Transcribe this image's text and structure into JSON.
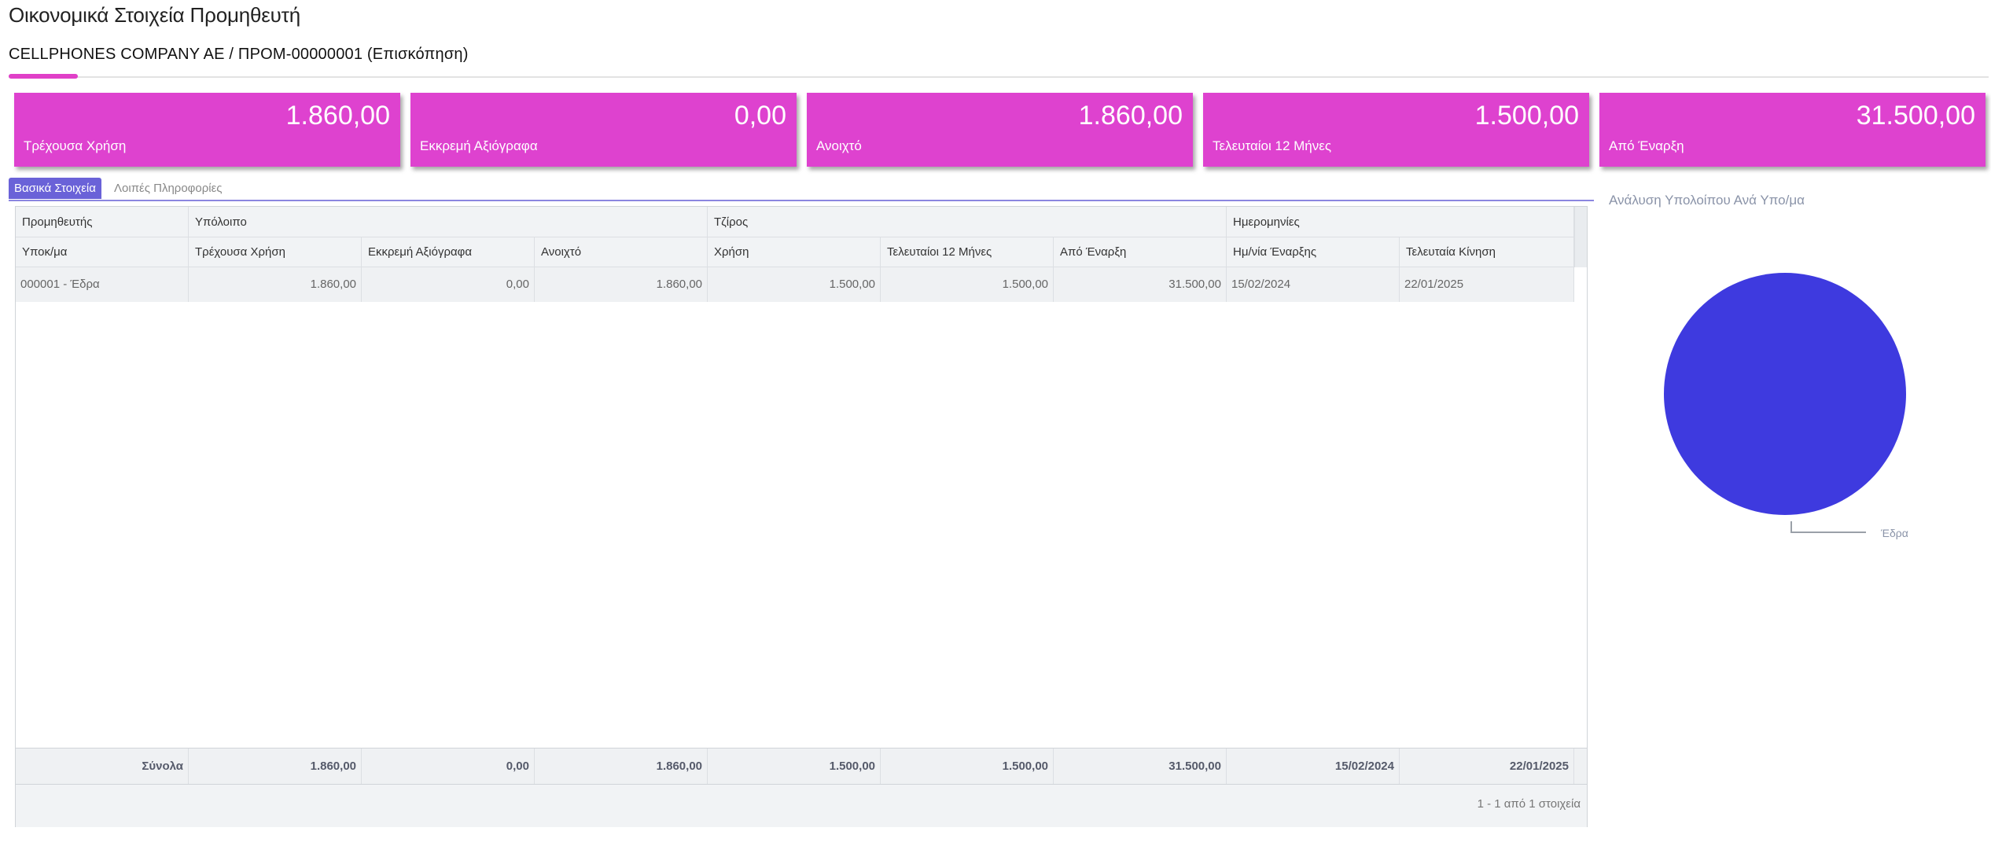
{
  "page": {
    "title": "Οικονομικά Στοιχεία Προμηθευτή",
    "breadcrumb": "CELLPHONES COMPANY AE / ΠΡΟΜ-00000001 (Επισκόπηση)"
  },
  "colors": {
    "accent": "#de42cf",
    "tab_active": "#6a62d8",
    "pie": "#3e3adf"
  },
  "kpis": [
    {
      "value": "1.860,00",
      "label": "Τρέχουσα Χρήση"
    },
    {
      "value": "0,00",
      "label": "Εκκρεμή Αξιόγραφα"
    },
    {
      "value": "1.860,00",
      "label": "Ανοιχτό"
    },
    {
      "value": "1.500,00",
      "label": "Τελευταίοι 12 Μήνες"
    },
    {
      "value": "31.500,00",
      "label": "Από Έναρξη"
    }
  ],
  "tabs": [
    {
      "label": "Βασικά Στοιχεία",
      "active": true
    },
    {
      "label": "Λοιπές Πληροφορίες",
      "active": false
    }
  ],
  "grid": {
    "groups": [
      "Προμηθευτής",
      "Υπόλοιπο",
      "Τζίρος",
      "Ημερομηνίες"
    ],
    "columns": [
      "Υποκ/μα",
      "Τρέχουσα Χρήση",
      "Εκκρεμή Αξιόγραφα",
      "Ανοιχτό",
      "Χρήση",
      "Τελευταίοι 12 Μήνες",
      "Από Έναρξη",
      "Ημ/νία Έναρξης",
      "Τελευταία Κίνηση"
    ],
    "rows": [
      [
        "000001 - Έδρα",
        "1.860,00",
        "0,00",
        "1.860,00",
        "1.500,00",
        "1.500,00",
        "31.500,00",
        "15/02/2024",
        "22/01/2025"
      ]
    ],
    "totals": [
      "Σύνολα",
      "1.860,00",
      "0,00",
      "1.860,00",
      "1.500,00",
      "1.500,00",
      "31.500,00",
      "15/02/2024",
      "22/01/2025"
    ],
    "pager": "1 - 1 από 1 στοιχεία"
  },
  "chart_data": {
    "type": "pie",
    "title": "Ανάλυση Υπολοίπου Ανά Υπο/μα",
    "categories": [
      "Έδρα"
    ],
    "values": [
      1860
    ],
    "legend": "bottom-right"
  }
}
